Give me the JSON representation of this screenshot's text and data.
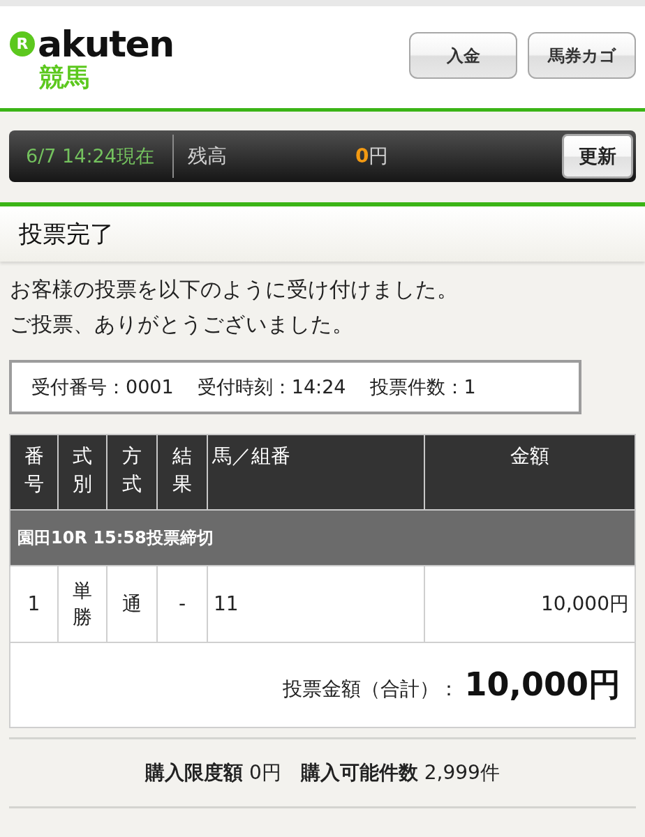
{
  "header": {
    "logo": {
      "wordmark": "Rakuten",
      "service": "競馬"
    },
    "buttons": [
      "入金",
      "馬券カゴ"
    ]
  },
  "balance_bar": {
    "as_of": "6/7 14:24現在",
    "label": "残高",
    "amount": "0",
    "unit": "円",
    "button": "更新"
  },
  "page_title": "投票完了",
  "message": [
    "お客様の投票を以下のように受け付けました。",
    "ご投票、ありがとうございました。"
  ],
  "receipt": [
    "受付番号：0001",
    "受付時刻：14:24",
    "投票件数：1"
  ],
  "table": {
    "columns": [
      "番号",
      "式別",
      "方式",
      "結果",
      "馬／組番",
      "金額"
    ],
    "groups": [
      {
        "title": "園田10R 15:58投票締切",
        "rows": [
          [
            "1",
            "単勝",
            "通",
            "-",
            "11",
            "10,000円"
          ]
        ]
      }
    ],
    "total": {
      "label": "投票金額（合計）：",
      "amount": "10,000円"
    }
  },
  "limits": "**購入限度額** 0円　**購入可能件数** 2,999件"
}
